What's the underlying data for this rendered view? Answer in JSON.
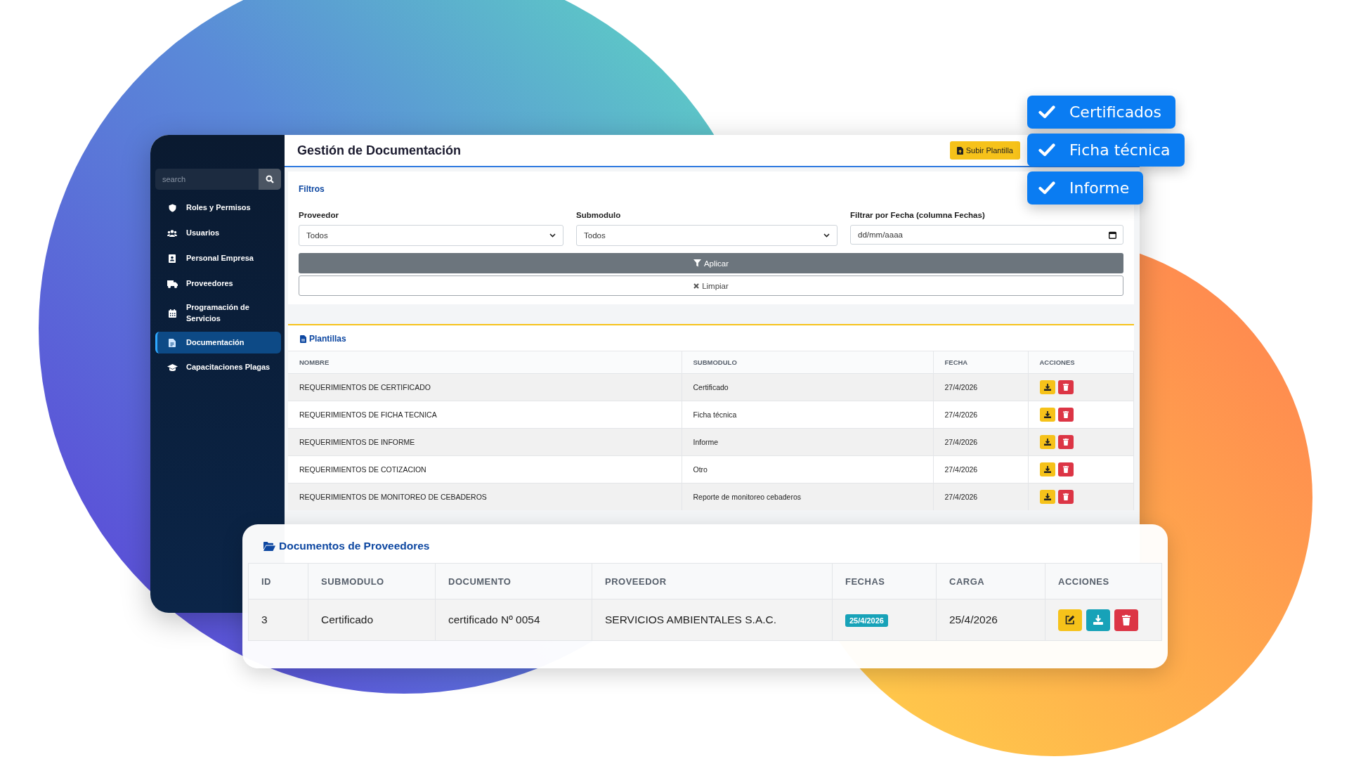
{
  "badges": [
    {
      "label": "Certificados"
    },
    {
      "label": "Ficha técnica"
    },
    {
      "label": "Informe"
    }
  ],
  "sidebar": {
    "search": {
      "placeholder": "search"
    },
    "items": [
      {
        "label": "Roles y Permisos",
        "selected": false
      },
      {
        "label": "Usuarios",
        "selected": false
      },
      {
        "label": "Personal Empresa",
        "selected": false
      },
      {
        "label": "Proveedores",
        "selected": false
      },
      {
        "label": "Programación de Servicios",
        "selected": false
      },
      {
        "label": "Documentación",
        "selected": true
      },
      {
        "label": "Capacitaciones Plagas",
        "selected": false
      }
    ]
  },
  "header": {
    "title": "Gestión de Documentación",
    "button": "Subir Plantilla"
  },
  "filters": {
    "title": "Filtros",
    "fields": [
      {
        "label": "Proveedor",
        "kind": "select",
        "value": "Todos"
      },
      {
        "label": "Submodulo",
        "kind": "select",
        "value": "Todos"
      },
      {
        "label": "Filtrar por Fecha (columna Fechas)",
        "kind": "date",
        "placeholder": "dd/mm/aaaa"
      }
    ],
    "apply": "Aplicar",
    "clear": "Limpiar"
  },
  "templates": {
    "title": "Plantillas",
    "columns": [
      "NOMBRE",
      "SUBMODULO",
      "FECHA",
      "ACCIONES"
    ],
    "rows": [
      {
        "nombre": "REQUERIMIENTOS DE CERTIFICADO",
        "submodulo": "Certificado",
        "fecha": "27/4/2026"
      },
      {
        "nombre": "REQUERIMIENTOS DE FICHA TECNICA",
        "submodulo": "Ficha técnica",
        "fecha": "27/4/2026"
      },
      {
        "nombre": "REQUERIMIENTOS DE INFORME",
        "submodulo": "Informe",
        "fecha": "27/4/2026"
      },
      {
        "nombre": "REQUERIMIENTOS DE COTIZACION",
        "submodulo": "Otro",
        "fecha": "27/4/2026"
      },
      {
        "nombre": "REQUERIMIENTOS DE MONITOREO DE CEBADEROS",
        "submodulo": "Reporte de monitoreo cebaderos",
        "fecha": "27/4/2026"
      }
    ]
  },
  "provider_docs": {
    "title": "Documentos de Proveedores",
    "columns": [
      "ID",
      "SUBMODULO",
      "DOCUMENTO",
      "PROVEEDOR",
      "FECHAS",
      "CARGA",
      "ACCIONES"
    ],
    "rows": [
      {
        "id": "3",
        "submodulo": "Certificado",
        "documento": "certificado Nº 0054",
        "proveedor": "SERVICIOS AMBIENTALES S.A.C.",
        "fechas": "25/4/2026",
        "carga": "25/4/2026"
      }
    ]
  }
}
